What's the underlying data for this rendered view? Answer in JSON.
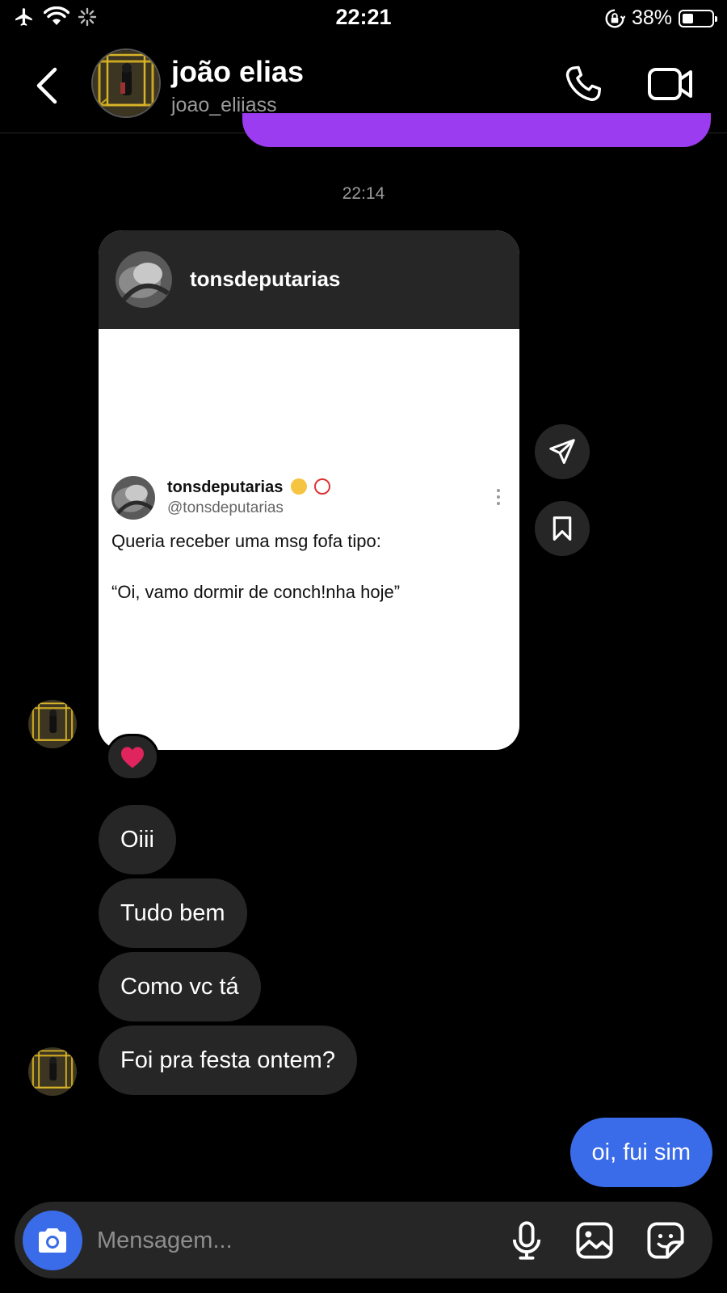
{
  "status_bar": {
    "time": "22:21",
    "battery_text": "38%",
    "battery_level": 0.38
  },
  "header": {
    "contact_name": "joão elias",
    "contact_username": "joao_eliiass"
  },
  "conversation": {
    "timestamp": "22:14",
    "shared_post": {
      "account": "tonsdeputarias",
      "tweet_name": "tonsdeputarias",
      "tweet_handle": "@tonsdeputarias",
      "tweet_line1": "Queria receber uma msg fofa tipo:",
      "tweet_line2": "“Oi, vamo dormir de conch!nha hoje”"
    },
    "reaction": "heart",
    "incoming_messages": [
      "Oiii",
      "Tudo bem",
      "Como vc tá",
      "Foi pra festa ontem?"
    ],
    "outgoing_message": "oi, fui sim"
  },
  "composer": {
    "placeholder": "Mensagem..."
  },
  "colors": {
    "background": "#000000",
    "incoming_bubble": "#262626",
    "outgoing_bubble": "#3a6be8",
    "previous_bubble": "#9b3cf0",
    "camera_button": "#3a6be8",
    "heart": "#e0245e"
  },
  "icons": [
    "airplane-icon",
    "wifi-icon",
    "loading-icon",
    "orientation-lock-icon",
    "battery-icon",
    "back-arrow-icon",
    "phone-icon",
    "video-camera-icon",
    "send-icon",
    "bookmark-icon",
    "heart-icon",
    "camera-icon",
    "microphone-icon",
    "gallery-icon",
    "sticker-icon"
  ]
}
